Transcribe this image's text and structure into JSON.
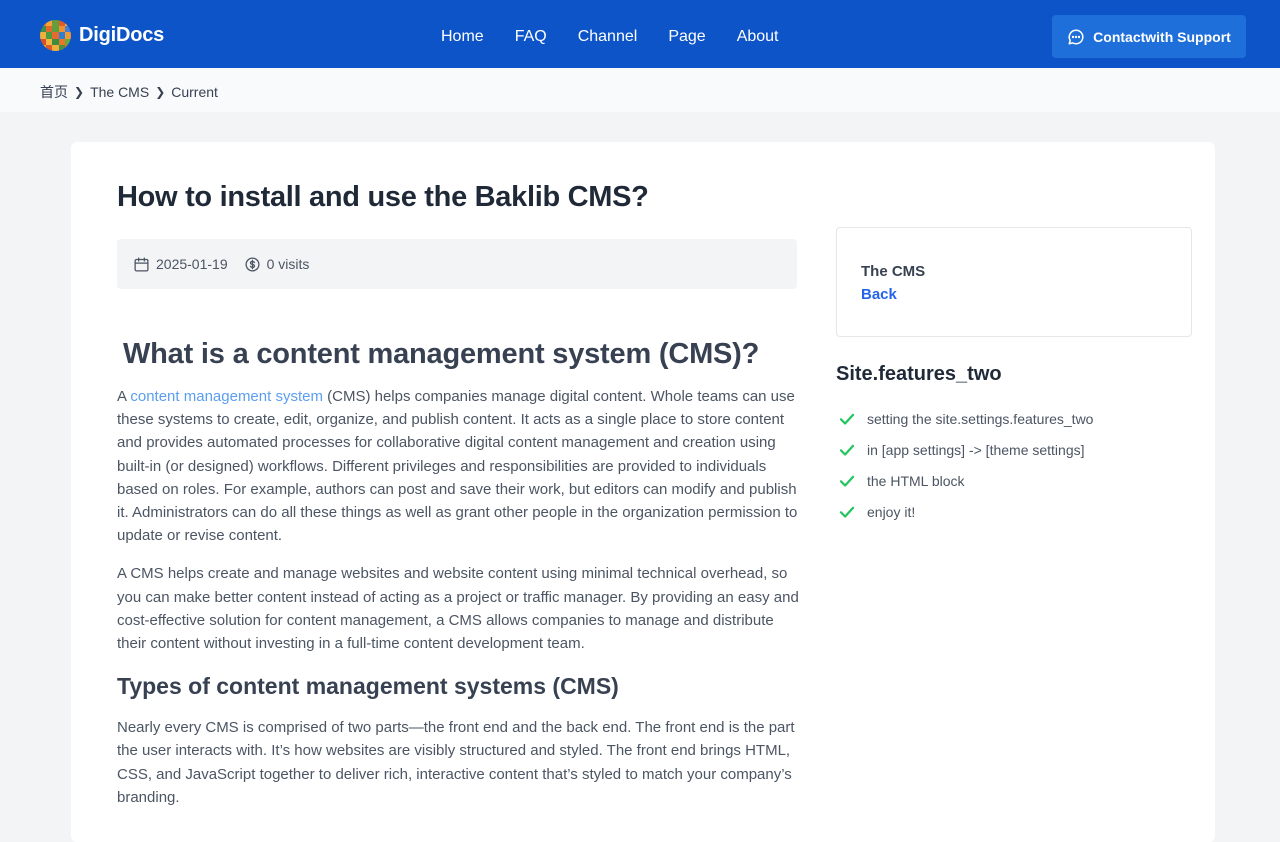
{
  "header": {
    "brand": "DigiDocs",
    "nav": [
      "Home",
      "FAQ",
      "Channel",
      "Page",
      "About"
    ],
    "support_label": "Contactwith Support",
    "colors": {
      "bar": "#0c54c8",
      "button": "#1e6fd9"
    }
  },
  "breadcrumb": [
    "首页",
    "The CMS",
    "Current"
  ],
  "article": {
    "title": "How to install and use the Baklib CMS?",
    "date": "2025-01-19",
    "visits": "0 visits",
    "h1": "What is a content management system (CMS)?",
    "p1_link": "content management system",
    "p1_prefix": "A ",
    "p1_rest": " (CMS) helps companies manage digital content. Whole teams can use these systems to create, edit, organize, and publish content. It acts as a single place to store content and provides automated processes for collaborative digital content management and creation using built-in (or designed) workflows. Different privileges and responsibilities are provided to individuals based on roles. For example, authors can post and save their work, but editors can modify and publish it. Administrators can do all these things as well as grant other people in the organization permission to update or revise content.",
    "p2": "A CMS helps create and manage websites and website content using minimal technical overhead, so you can make better content instead of acting as a project or traffic manager. By providing an easy and cost-effective solution for content management, a CMS allows companies to manage and distribute their content without investing in a full-time content development team.",
    "h2": "Types of content management systems (CMS)",
    "p3": "Nearly every CMS is comprised of two parts—the front end and the back end. The front end is the part the user interacts with. It’s how websites are visibly structured and styled. The front end brings HTML, CSS, and JavaScript together to deliver rich, interactive content that’s styled to match your company’s branding."
  },
  "sidebar": {
    "channel_name": "The CMS",
    "back_label": "Back",
    "features_title": "Site.features_two",
    "features": [
      "setting the site.settings.features_two",
      "in [app settings] -> [theme settings]",
      "the HTML block",
      "enjoy it!"
    ],
    "check_color": "#22c55e"
  },
  "icons": [
    "logo-icon",
    "chat-icon",
    "calendar-icon",
    "dollar-icon",
    "chevron-right-icon",
    "check-icon"
  ]
}
